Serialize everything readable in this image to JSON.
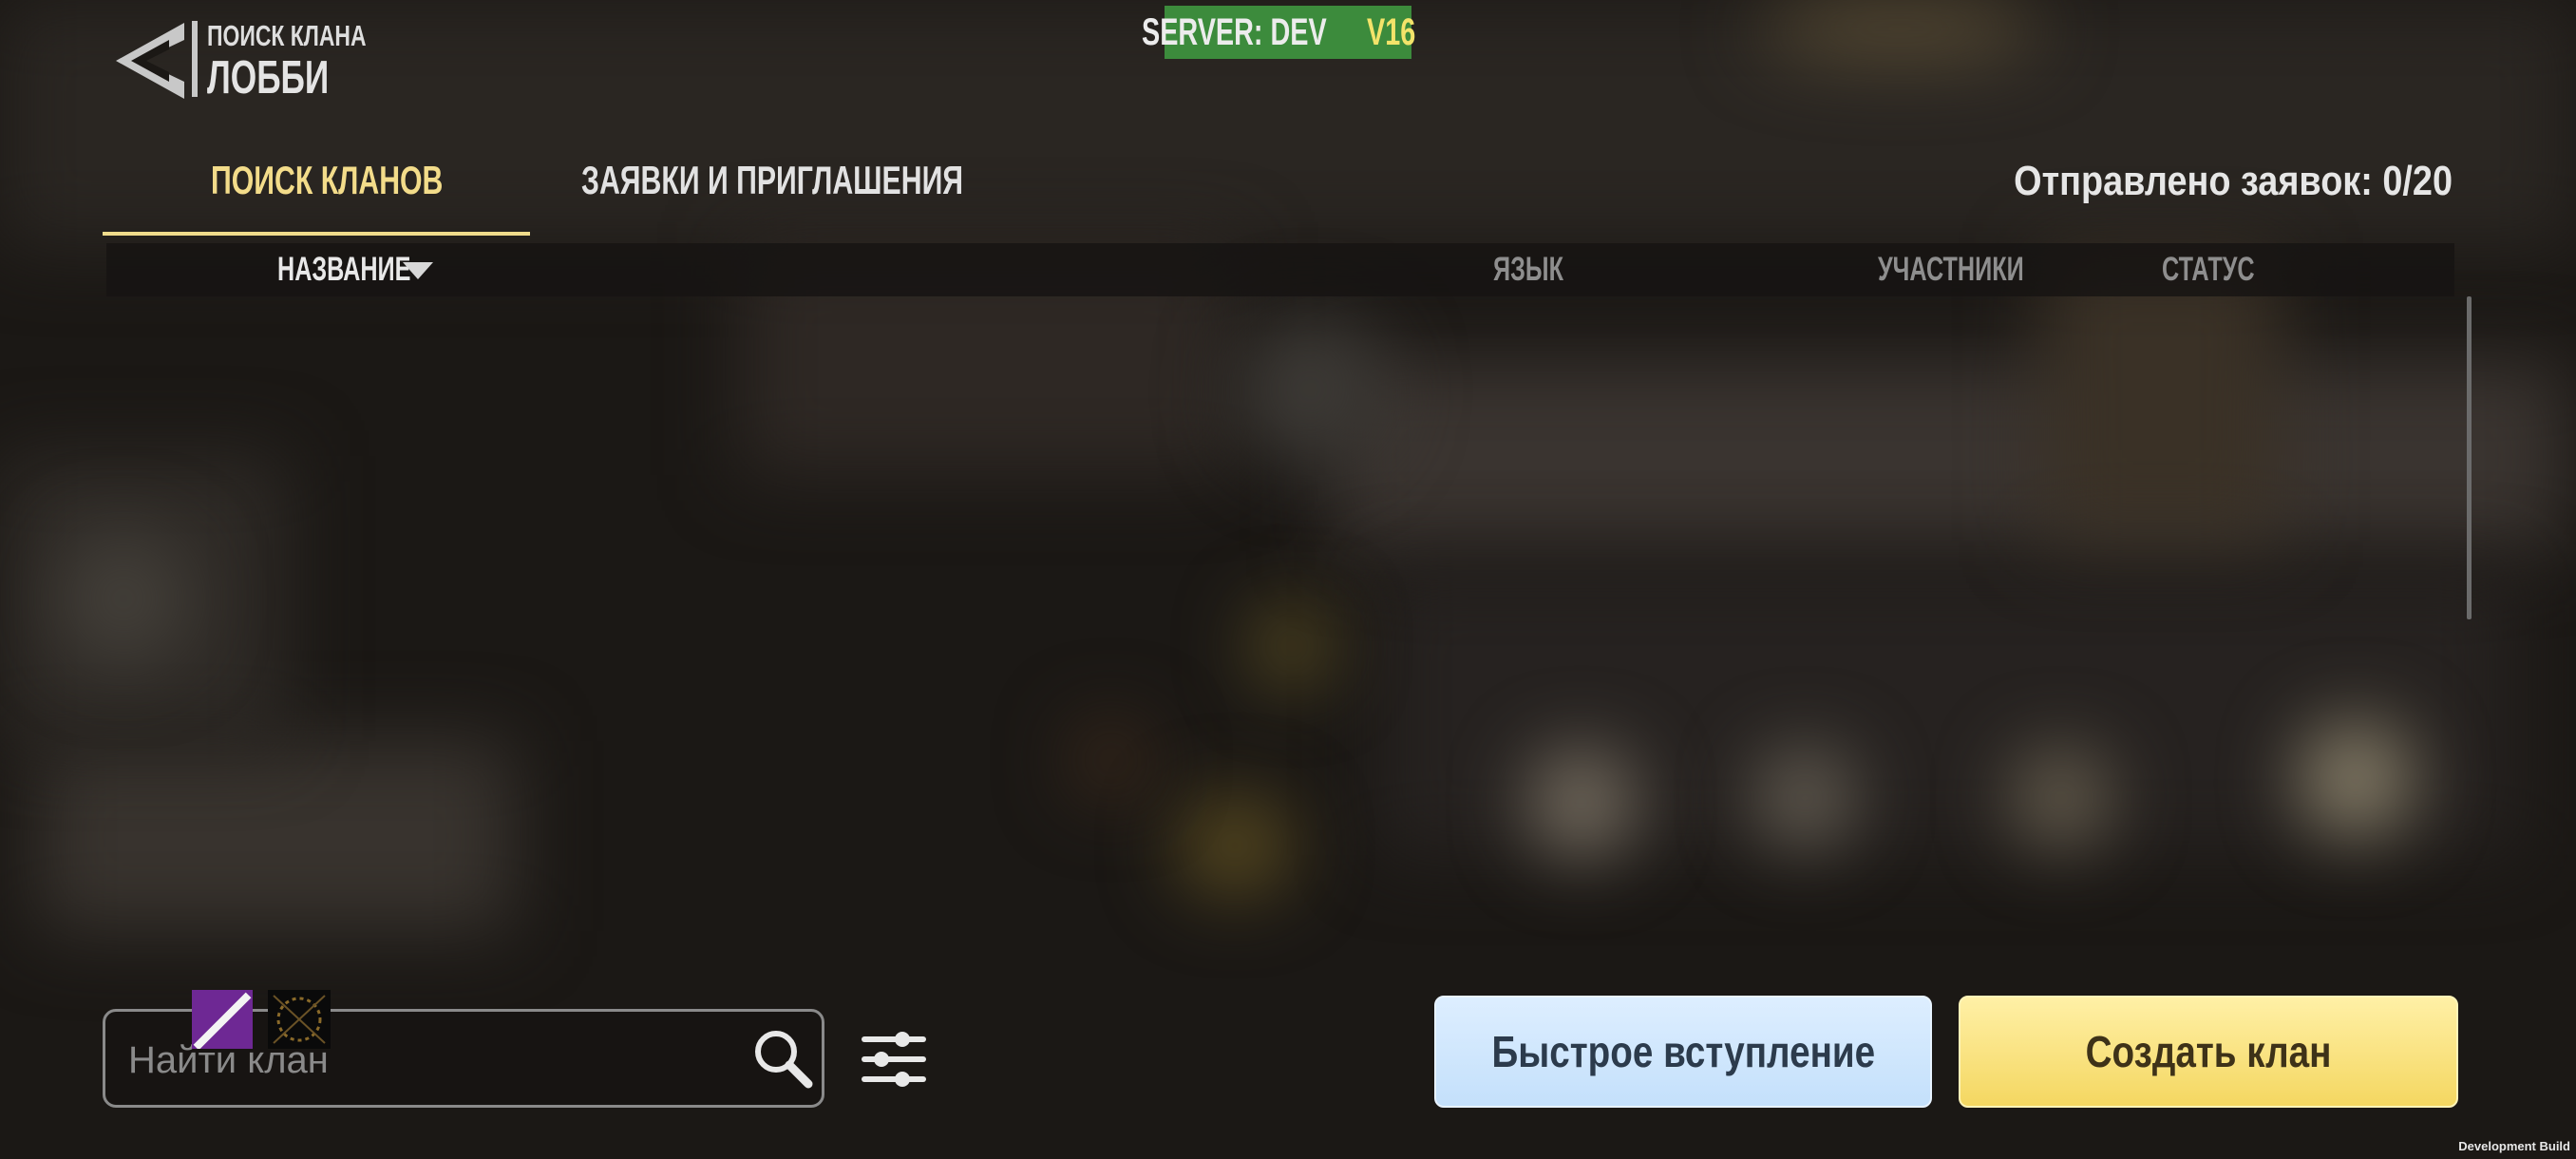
{
  "header": {
    "back_icon": "back-arrow-icon",
    "subtitle": "ПОИСК КЛАНА",
    "title": "ЛОББИ"
  },
  "server_badge": {
    "server": "SERVER: DEV",
    "version": "V16",
    "bg_color": "#3c8b3c",
    "version_color": "#f3e36a"
  },
  "tabs": [
    {
      "label": "ПОИСК КЛАНОВ",
      "active": true
    },
    {
      "label": "ЗАЯВКИ И ПРИГЛАШЕНИЯ",
      "active": false
    }
  ],
  "requests_sent": "Отправлено заявок: 0/20",
  "table": {
    "columns": [
      "НАЗВАНИЕ",
      "ЯЗЫК",
      "УЧАСТНИКИ",
      "СТАТУС"
    ],
    "sort_icon": "sort-down-icon",
    "rows": []
  },
  "search": {
    "placeholder": "Найти клан",
    "value": "",
    "icon": "search-icon"
  },
  "filter_icon": "sliders-icon",
  "buttons": {
    "quick_join": "Быстрое вступление",
    "create_clan": "Создать клан"
  },
  "colors": {
    "accent_tab": "#f3dc8a",
    "quick_join_bg": "#cfe6fc",
    "create_clan_bg": "#f8e27a"
  },
  "footer": {
    "build_label": "Development Build"
  }
}
